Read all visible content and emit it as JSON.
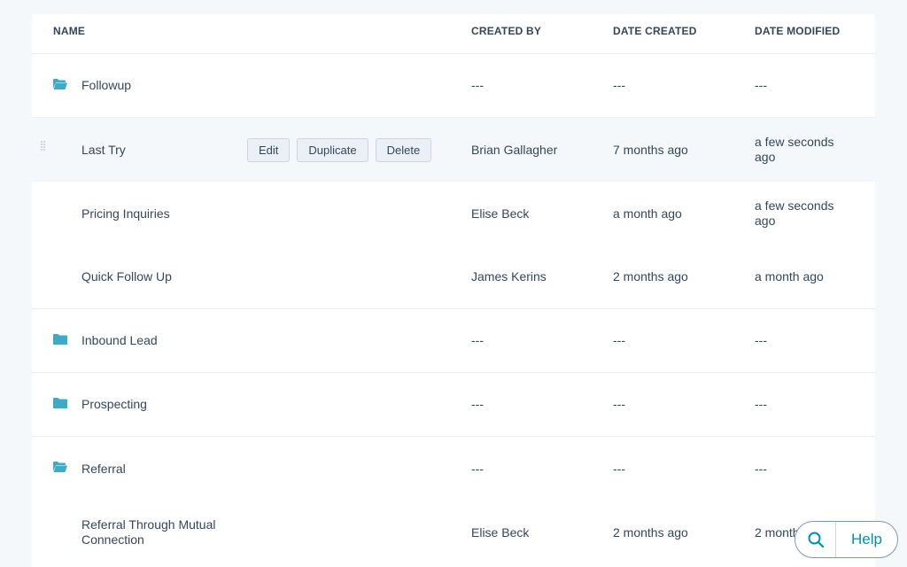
{
  "table": {
    "headers": {
      "name": "NAME",
      "created_by": "CREATED BY",
      "date_created": "DATE CREATED",
      "date_modified": "DATE MODIFIED"
    },
    "rows": [
      {
        "type": "folder",
        "name": "Followup",
        "created_by": "---",
        "date_created": "---",
        "date_modified": "---",
        "icon": "folder-open-icon"
      },
      {
        "type": "item",
        "name": "Last Try",
        "created_by": "Brian Gallagher",
        "date_created": "7 months ago",
        "date_modified": "a few seconds ago",
        "hovered": true
      },
      {
        "type": "item",
        "name": "Pricing Inquiries",
        "created_by": "Elise Beck",
        "date_created": "a month ago",
        "date_modified": "a few seconds ago"
      },
      {
        "type": "item",
        "name": "Quick Follow Up",
        "created_by": "James Kerins",
        "date_created": "2 months ago",
        "date_modified": "a month ago"
      },
      {
        "type": "folder",
        "name": "Inbound Lead",
        "created_by": "---",
        "date_created": "---",
        "date_modified": "---",
        "icon": "folder-icon"
      },
      {
        "type": "folder",
        "name": "Prospecting",
        "created_by": "---",
        "date_created": "---",
        "date_modified": "---",
        "icon": "folder-icon"
      },
      {
        "type": "folder",
        "name": "Referral",
        "created_by": "---",
        "date_created": "---",
        "date_modified": "---",
        "icon": "folder-open-icon"
      },
      {
        "type": "item",
        "name": "Referral Through Mutual Connection",
        "created_by": "Elise Beck",
        "date_created": "2 months ago",
        "date_modified": "2 months ago"
      }
    ]
  },
  "row_actions": {
    "edit_label": "Edit",
    "duplicate_label": "Duplicate",
    "delete_label": "Delete"
  },
  "help": {
    "label": "Help",
    "search_icon": "search-icon"
  },
  "colors": {
    "accent": "#0091ae",
    "folder": "#40a9c4",
    "text": "#33475b",
    "border": "#eaf0f6",
    "background": "#f5f8fa"
  }
}
